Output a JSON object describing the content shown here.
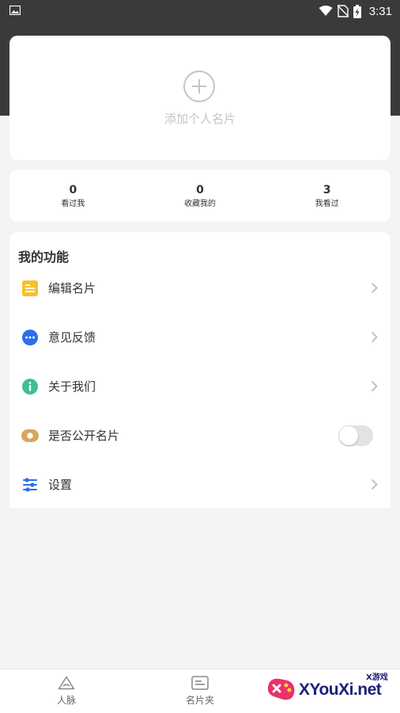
{
  "status_bar": {
    "time": "3:31"
  },
  "profile": {
    "add_card_label": "添加个人名片"
  },
  "stats": [
    {
      "value": "0",
      "label": "看过我"
    },
    {
      "value": "0",
      "label": "收藏我的"
    },
    {
      "value": "3",
      "label": "我看过"
    }
  ],
  "functions": {
    "title": "我的功能",
    "items": [
      {
        "label": "编辑名片",
        "icon": "edit-card-icon",
        "color": "#f6c12c"
      },
      {
        "label": "意见反馈",
        "icon": "feedback-icon",
        "color": "#2b6fe8"
      },
      {
        "label": "关于我们",
        "icon": "info-icon",
        "color": "#3fbf95"
      },
      {
        "label": "是否公开名片",
        "icon": "public-card-icon",
        "color": "#d8a55a",
        "toggle_on": false
      },
      {
        "label": "设置",
        "icon": "settings-icon",
        "color": "#2b6fe8"
      }
    ]
  },
  "bottom_nav": [
    {
      "label": "人脉",
      "icon": "contacts-icon"
    },
    {
      "label": "名片夹",
      "icon": "card-holder-icon"
    }
  ],
  "watermark": {
    "text": "XYouXi.net",
    "sub": "X游戏"
  }
}
